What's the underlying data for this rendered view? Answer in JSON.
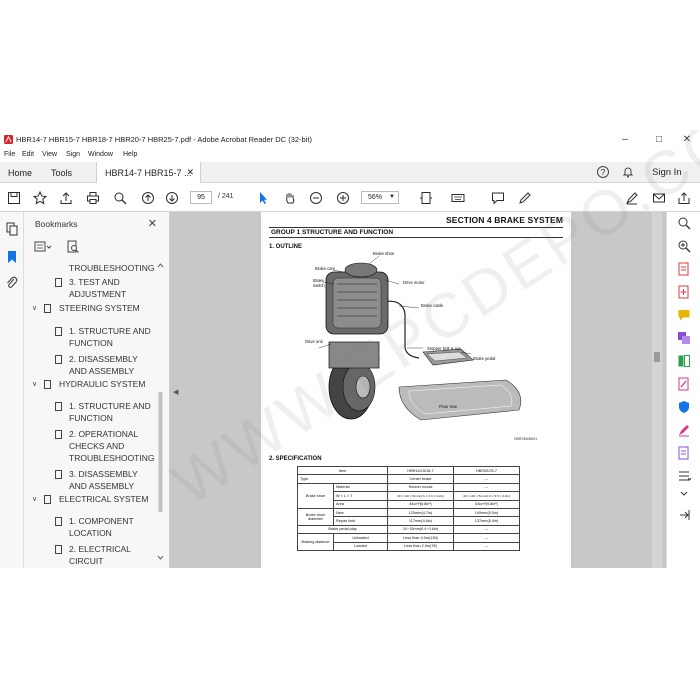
{
  "window": {
    "title": "HBR14-7 HBR15-7 HBR18-7 HBR20-7 HBR25-7.pdf - Adobe Acrobat Reader DC (32-bit)"
  },
  "menu": [
    "File",
    "Edit",
    "View",
    "Sign",
    "Window",
    "Help"
  ],
  "tabs": {
    "home": "Home",
    "tools": "Tools",
    "document": "HBR14-7 HBR15-7 ..."
  },
  "header": {
    "sign_in": "Sign In"
  },
  "toolbar": {
    "page_current": "95",
    "page_total": "/ 241",
    "zoom": "56%"
  },
  "bookmarks": {
    "title": "Bookmarks",
    "items": [
      {
        "label": "TROUBLESHOOTING",
        "level": 2
      },
      {
        "label": "3. TEST AND ADJUSTMENT",
        "level": 2
      },
      {
        "label": "STEERING SYSTEM",
        "level": 1
      },
      {
        "label": "1. STRUCTURE AND FUNCTION",
        "level": 2
      },
      {
        "label": "2. DISASSEMBLY AND ASSEMBLY",
        "level": 2
      },
      {
        "label": "HYDRAULIC SYSTEM",
        "level": 1
      },
      {
        "label": "1. STRUCTURE AND FUNCTION",
        "level": 2
      },
      {
        "label": "2. OPERATIONAL CHECKS AND TROUBLESHOOTING",
        "level": 2
      },
      {
        "label": "3. DISASSEMBLY AND ASSEMBLY",
        "level": 2
      },
      {
        "label": "ELECTRICAL SYSTEM",
        "level": 1
      },
      {
        "label": "1. COMPONENT LOCATION",
        "level": 2
      },
      {
        "label": "2. ELECTRICAL CIRCUIT",
        "level": 2
      }
    ]
  },
  "pdf_page": {
    "section": "SECTION  4  BRAKE SYSTEM",
    "group": "GROUP  1  STRUCTURE AND FUNCTION",
    "outline_heading": "1. OUTLINE",
    "spec_heading": "2. SPECIFICATION",
    "figure_code": "HBRSM4BS01",
    "labels": {
      "brake_shoe": "Brake shoe",
      "brake_cam": "Brake cam",
      "brake_switch": "Brake\nswitch",
      "drive_motor": "Drive motor",
      "brake_cable": "Brake cable",
      "drive_unit": "Drive unit",
      "stopper": "Stopper bolt & nut",
      "brake_pedal": "Brake pedal",
      "floor_mat": "Floor mat"
    },
    "spec_table": {
      "header": [
        "Item",
        "HBR14/15/18-7",
        "HBR20/25-7"
      ],
      "rows": [
        [
          "Type",
          "",
          "Center brake",
          "←"
        ],
        [
          "Brake shoe",
          "Material",
          "Rubber mould",
          "←"
        ],
        [
          "",
          "W × L × T",
          "40 × 110 × 5mm(1.6 × 4.3 × 0.2in)",
          "40 × 140 × 5mm(1.6 × 5.5 × 0.2in)"
        ],
        [
          "",
          "Area",
          "44cm²(6.8in²)",
          "63cm²(9.8in²)"
        ],
        [
          "Brake drum diameter",
          "New",
          "120mm(4.7in)",
          "140mm(5.5in)"
        ],
        [
          "",
          "Repair limit",
          "117mm(4.6in)",
          "137mm(5.4in)"
        ],
        [
          "Brake pedal play",
          "",
          "10~15mm(0.4~0.6in)",
          "←"
        ],
        [
          "Braking distance",
          "Unloaded",
          "Less than 4.0m(13ft)",
          "←"
        ],
        [
          "",
          "Loaded",
          "Less than 2.0m(7ft)",
          "←"
        ]
      ]
    }
  },
  "watermark": "WWW.EPCDEPO.COM",
  "colors": {
    "toolbar_icon": "#2b2b2b",
    "select_arrow": "#1473e6",
    "rail_red": "#e03a3a",
    "rail_purple": "#8a4fd8",
    "rail_green": "#2aa24a",
    "rail_yellow": "#e8b400",
    "rail_pink": "#d9368b"
  }
}
